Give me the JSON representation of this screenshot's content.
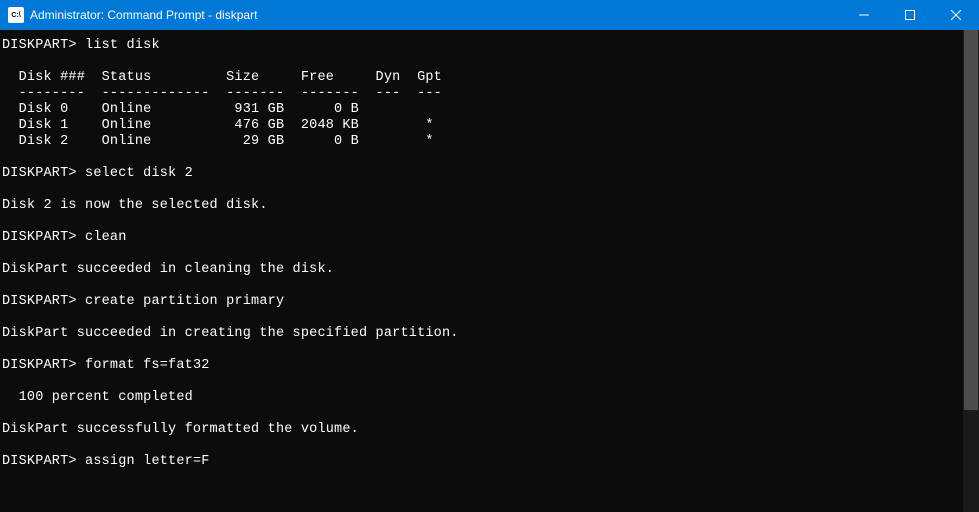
{
  "titlebar": {
    "icon_text": "C:\\",
    "title": "Administrator: Command Prompt - diskpart"
  },
  "terminal": {
    "prompt": "DISKPART>",
    "commands": {
      "c1": "list disk",
      "c2": "select disk 2",
      "c3": "clean",
      "c4": "create partition primary",
      "c5": "format fs=fat32",
      "c6": "assign letter=F"
    },
    "disk_table": {
      "header": "  Disk ###  Status         Size     Free     Dyn  Gpt",
      "divider": "  --------  -------------  -------  -------  ---  ---",
      "rows": [
        "  Disk 0    Online          931 GB      0 B",
        "  Disk 1    Online          476 GB  2048 KB        *",
        "  Disk 2    Online           29 GB      0 B        *"
      ]
    },
    "messages": {
      "m1": "Disk 2 is now the selected disk.",
      "m2": "DiskPart succeeded in cleaning the disk.",
      "m3": "DiskPart succeeded in creating the specified partition.",
      "m4": "  100 percent completed",
      "m5": "DiskPart successfully formatted the volume."
    }
  }
}
